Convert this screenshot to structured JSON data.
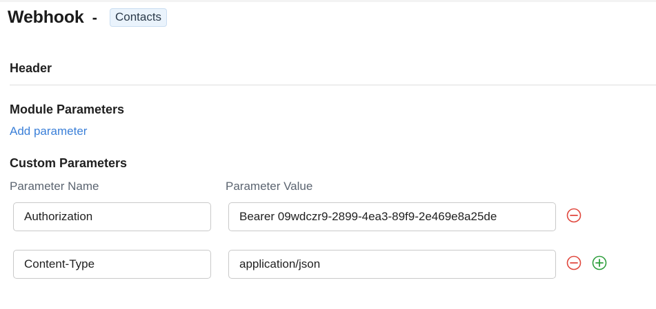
{
  "header": {
    "title": "Webhook",
    "separator": "-",
    "module": "Contacts"
  },
  "sections": {
    "header_label": "Header",
    "module_params_label": "Module Parameters",
    "add_parameter_label": "Add parameter",
    "custom_params_label": "Custom Parameters"
  },
  "columns": {
    "name": "Parameter Name",
    "value": "Parameter Value"
  },
  "custom_params": [
    {
      "name": "Authorization",
      "value": "Bearer 09wdczr9-2899-4ea3-89f9-2e469e8a25de"
    },
    {
      "name": "Content-Type",
      "value": "application/json"
    }
  ],
  "icons": {
    "remove": "minus-circle-icon",
    "add": "plus-circle-icon"
  },
  "colors": {
    "link": "#3a7fd8",
    "remove": "#e0463c",
    "add": "#2e9e3c",
    "badge_bg": "#eaf3fc"
  }
}
